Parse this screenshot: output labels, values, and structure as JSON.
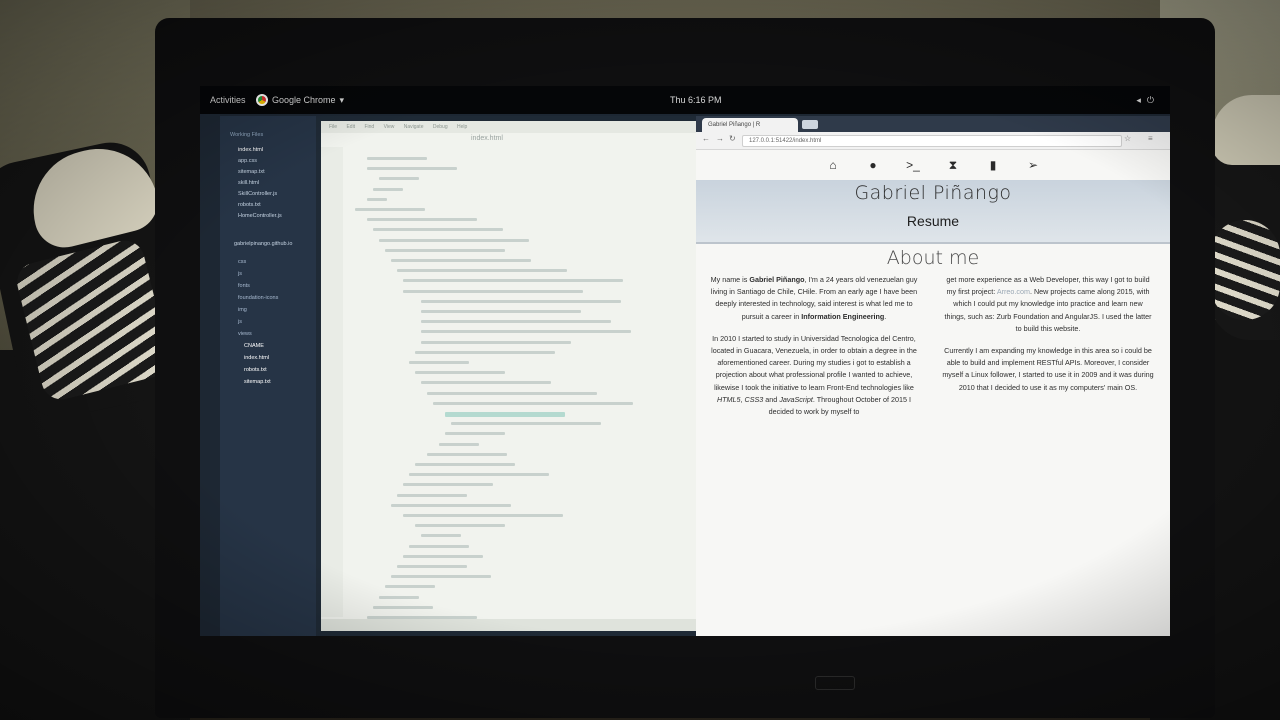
{
  "topbar": {
    "activities": "Activities",
    "app_menu": "Google Chrome",
    "clock": "Thu  6:16 PM"
  },
  "editor": {
    "tree_header": "Working Files",
    "open_files": [
      "index.html",
      "app.css",
      "sitemap.txt",
      "skill.html",
      "SkillController.js",
      "robots.txt",
      "HomeController.js"
    ],
    "project_root": "gabrielpinango.github.io",
    "folders": [
      "css",
      "js",
      "fonts",
      "foundation-icons",
      "img",
      "js",
      "views",
      "CNAME",
      "index.html",
      "robots.txt",
      "sitemap.txt"
    ],
    "tab_title": "index.html",
    "menu": [
      "File",
      "Edit",
      "Find",
      "View",
      "Navigate",
      "Debug",
      "Help"
    ]
  },
  "browser": {
    "tab_title": "Gabriel Piñango | R",
    "url": "127.0.0.1:51422/index.html",
    "page": {
      "name": "Gabriel Piñango",
      "subtitle": "Resume",
      "about_title": "About me",
      "left_p1_a": "My name is ",
      "left_p1_name": "Gabriel Piñango",
      "left_p1_b": ", I'm a 24 years old venezuelan guy living in Santiago de Chile, CHile. From an early age I have been deeply interested in technology, said interest is what led me to pursuit a career in ",
      "left_p1_career": "Information Engineering",
      "left_p1_c": ".",
      "left_p2_a": "In 2010 I started to study in Universidad Tecnologica del Centro, located in Guacara, Venezuela, in order to obtain a degree in the aforementioned career. During my studies i got to establish a projection about what professional profile I wanted to achieve, likewise I took the initiative to learn Front-End technologies like ",
      "left_p2_html": "HTML5",
      "left_p2_sep": ", ",
      "left_p2_css": "CSS3",
      "left_p2_and": " and ",
      "left_p2_js": "JavaScript",
      "left_p2_b": ". Throughout October of 2015 I decided to work by myself to",
      "right_p1_a": "get more experience as a Web Developer, this way I got to build my first project: ",
      "right_p1_link": "Arreo.com",
      "right_p1_b": ". New projects came along 2015, with which I could put my knowledge into practice and learn new things, such as: Zurb Foundation and AngularJS. I used the latter to build this website.",
      "right_p2": "Currently I am expanding my knowledge in this area so i could be able to build and implement RESTful APIs. Moreover, I consider myself a Linux follower, I started to use it in 2009 and it was during 2010 that I decided to use it as my computers' main OS."
    }
  },
  "icons": [
    "home-icon",
    "user-icon",
    "terminal-icon",
    "hourglass-icon",
    "book-icon",
    "paper-plane-icon",
    "star-icon",
    "menu-icon",
    "back-icon",
    "forward-icon",
    "reload-icon"
  ]
}
